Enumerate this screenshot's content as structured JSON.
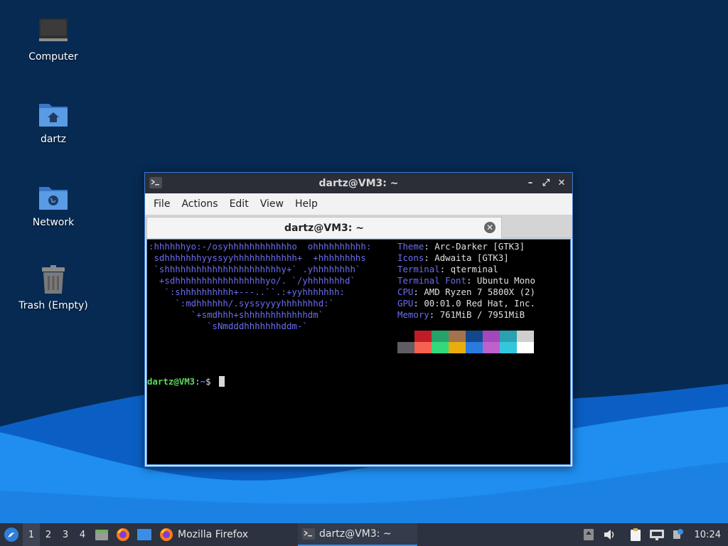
{
  "desktop": {
    "icons": [
      {
        "label": "Computer",
        "icon": "computer-icon"
      },
      {
        "label": "dartz",
        "icon": "home-folder-icon"
      },
      {
        "label": "Network",
        "icon": "network-folder-icon"
      },
      {
        "label": "Trash (Empty)",
        "icon": "trash-icon"
      }
    ]
  },
  "window": {
    "title": "dartz@VM3: ~",
    "menu": [
      "File",
      "Actions",
      "Edit",
      "View",
      "Help"
    ],
    "tab_label": "dartz@VM3: ~",
    "controls": {
      "minimize": "–",
      "maximize": "⤢",
      "close": "✕"
    }
  },
  "terminal": {
    "logo_lines": [
      ":hhhhhhyo:-/osyhhhhhhhhhhhho  ohhhhhhhhhh:",
      " sdhhhhhhhyyssyyhhhhhhhhhhhh+  +hhhhhhhhs",
      " `shhhhhhhhhhhhhhhhhhhhhhy+` .yhhhhhhhh`",
      "  +sdhhhhhhhhhhhhhhhhhyo/. `/yhhhhhhhd`",
      "   `:shhhhhhhhhh+---..``.:+yyhhhhhhh:",
      "     `:mdhhhhhh/.syssyyyyhhhhhhhd:`",
      "        `+smdhhh+shhhhhhhhhhhhdm`",
      "           `sNmdddhhhhhhhddm-`"
    ],
    "info": [
      {
        "key": "Theme",
        "value": "Arc-Darker [GTK3]"
      },
      {
        "key": "Icons",
        "value": "Adwaita [GTK3]"
      },
      {
        "key": "Terminal",
        "value": "qterminal"
      },
      {
        "key": "Terminal Font",
        "value": "Ubuntu Mono"
      },
      {
        "key": "CPU",
        "value": "AMD Ryzen 7 5800X (2)"
      },
      {
        "key": "GPU",
        "value": "00:01.0 Red Hat, Inc."
      },
      {
        "key": "Memory",
        "value": "761MiB / 7951MiB"
      }
    ],
    "palette_top": [
      "#000000",
      "#c01c28",
      "#26a269",
      "#a2734c",
      "#12488b",
      "#a347ba",
      "#2aa1b3",
      "#d0cfcc"
    ],
    "palette_bottom": [
      "#5e5c64",
      "#f66151",
      "#33da7a",
      "#e9ad0c",
      "#2a7bde",
      "#c061cb",
      "#33c7de",
      "#ffffff"
    ],
    "prompt": {
      "user_host": "dartz@VM3",
      "sep": ":",
      "path": "~",
      "symbol": "$"
    }
  },
  "taskbar": {
    "workspaces": [
      "1",
      "2",
      "3",
      "4"
    ],
    "active_workspace": 0,
    "tasks": [
      {
        "label": "Mozilla Firefox",
        "icon": "firefox-icon"
      },
      {
        "label": "dartz@VM3: ~",
        "icon": "terminal-icon"
      }
    ],
    "clock": "10:24"
  },
  "colors": {
    "desktop_bg": "#062a52",
    "wave_light": "#1f8ef0",
    "wave_dark": "#0b5fc4",
    "accent": "#3a8ee6"
  }
}
